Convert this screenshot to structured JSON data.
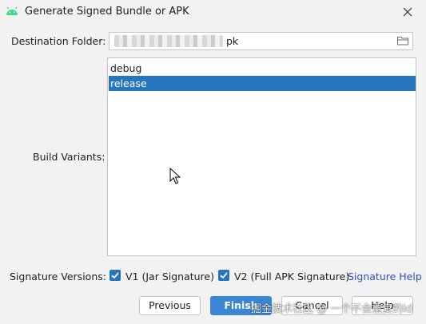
{
  "window": {
    "title": "Generate Signed Bundle or APK",
    "app_icon": "android-icon",
    "close_icon": "close-icon"
  },
  "destination": {
    "label": "Destination Folder:",
    "value_visible": "pk",
    "browse_icon": "folder-icon"
  },
  "build_variants": {
    "label": "Build Variants:",
    "items": [
      {
        "label": "debug",
        "selected": false
      },
      {
        "label": "release",
        "selected": true
      }
    ]
  },
  "signature": {
    "label": "Signature Versions:",
    "options": [
      {
        "label": "V1 (Jar Signature)",
        "checked": true
      },
      {
        "label": "V2 (Full APK Signature)",
        "checked": true
      }
    ],
    "help_link": "Signature Help"
  },
  "buttons": {
    "previous": "Previous",
    "finish": "Finish",
    "cancel": "Cancel",
    "help": "Help"
  },
  "watermark": "掘金技术社区 @ 一个不会重复的id",
  "colors": {
    "accent": "#2675bf",
    "link": "#2c4fbf",
    "android_green": "#3ddc84",
    "background": "#f2f2f2"
  }
}
